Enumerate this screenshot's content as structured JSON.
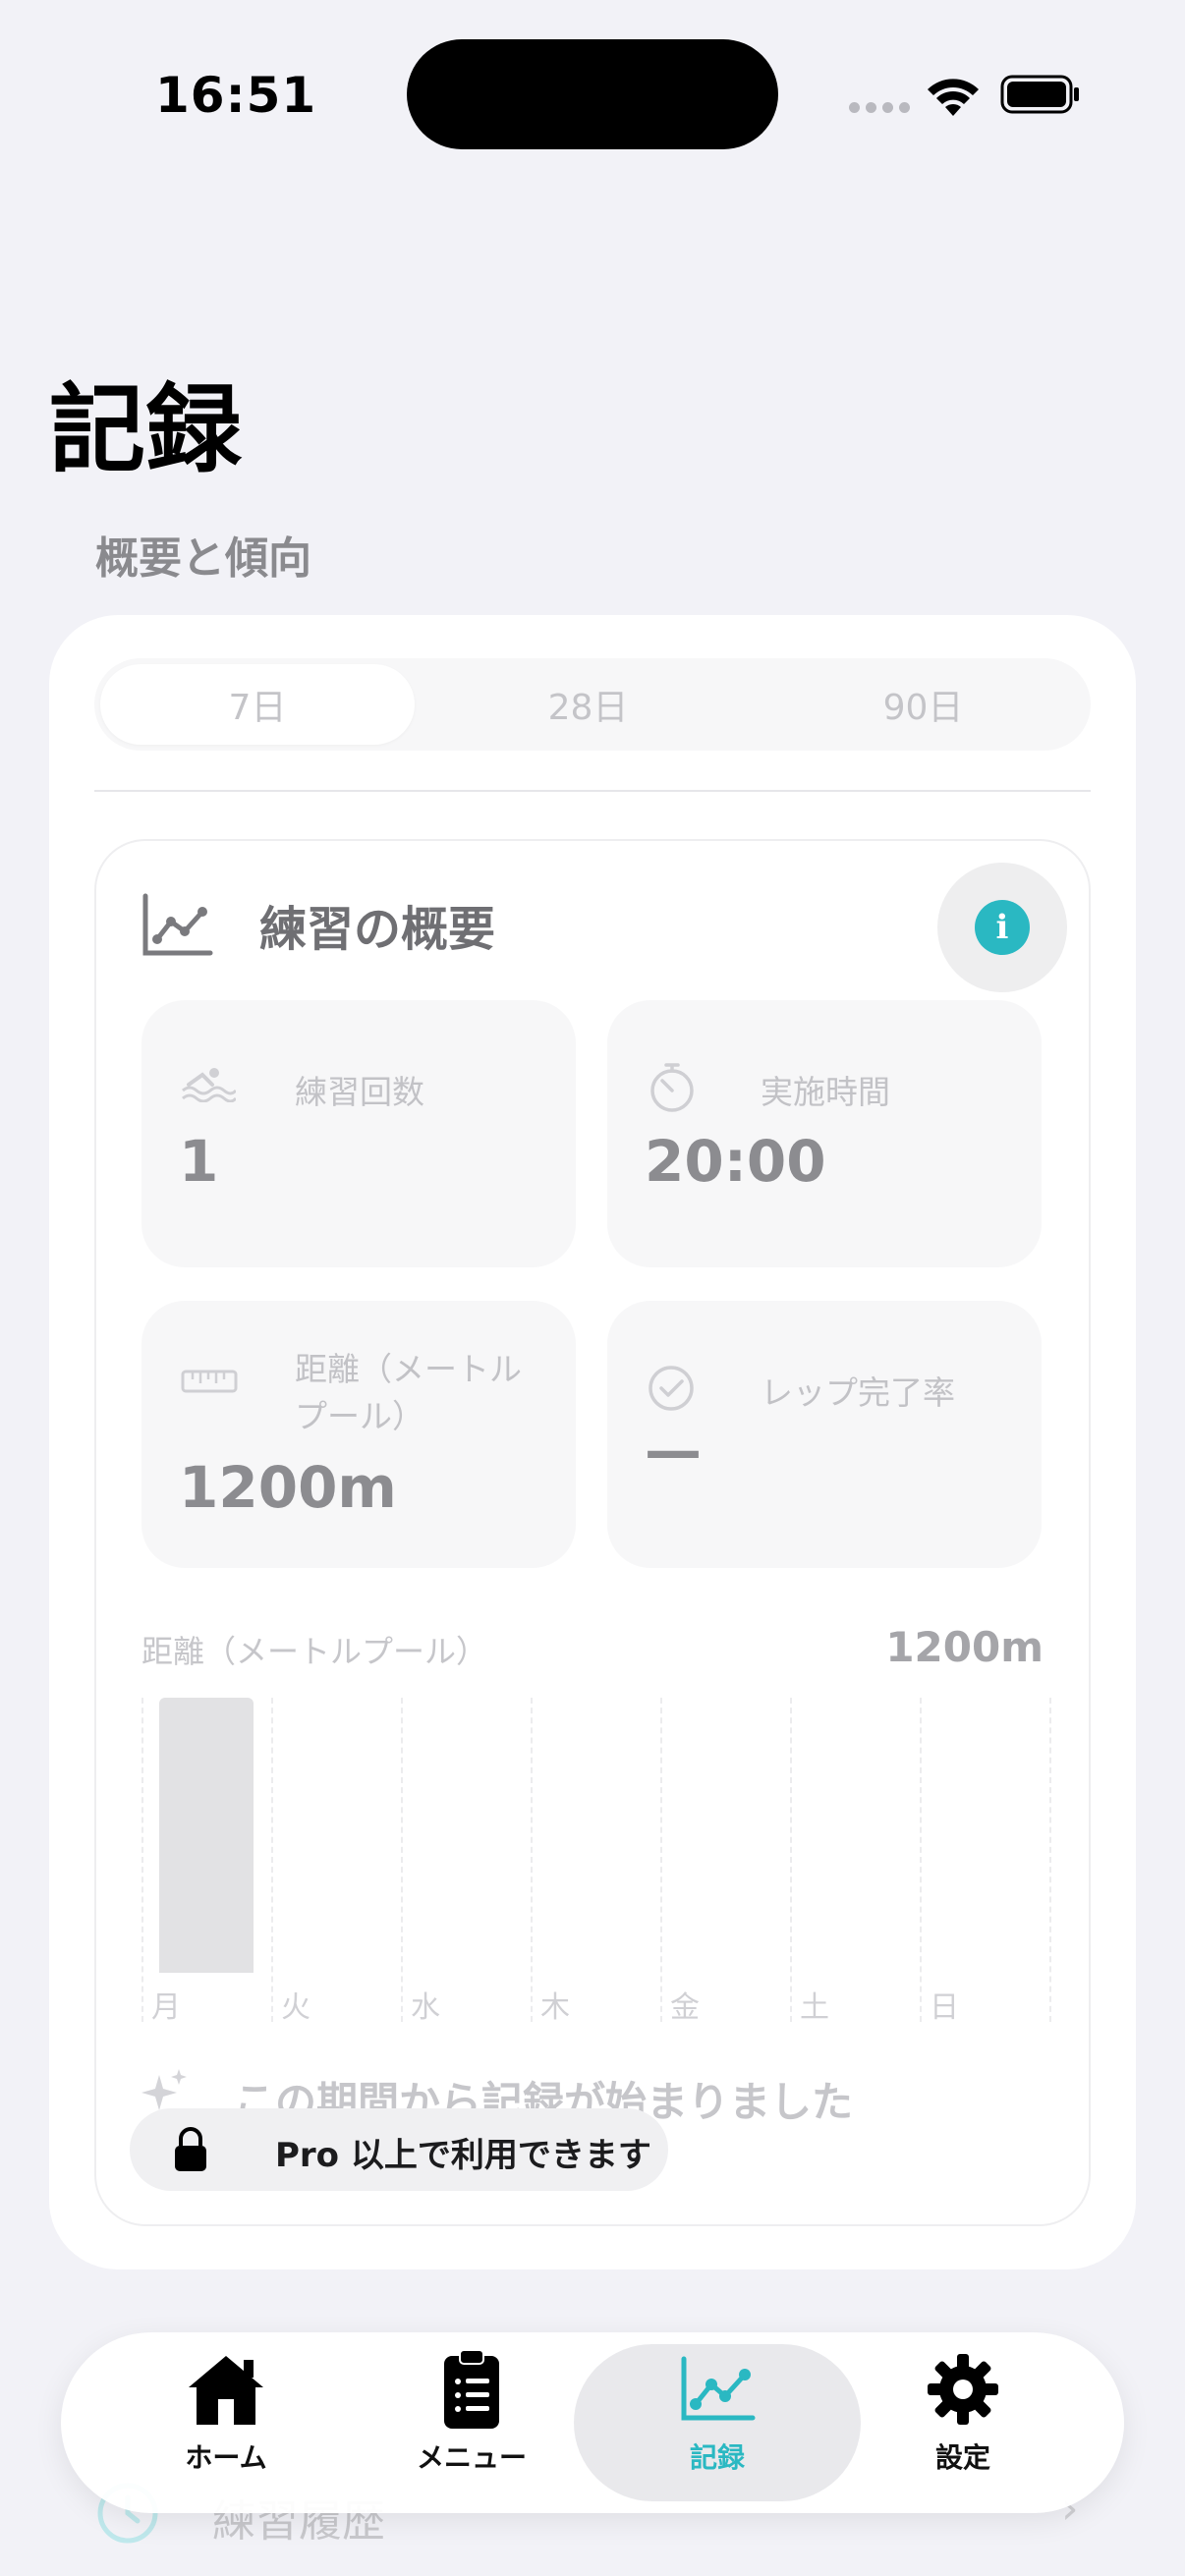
{
  "status_bar": {
    "time": "16:51"
  },
  "page": {
    "title": "記録",
    "section_label": "概要と傾向"
  },
  "period_tabs": [
    {
      "label": "7日",
      "active": true
    },
    {
      "label": "28日",
      "active": false
    },
    {
      "label": "90日",
      "active": false
    }
  ],
  "overview": {
    "title": "練習の概要",
    "stats": {
      "sessions": {
        "label": "練習回数",
        "value": "1"
      },
      "duration": {
        "label": "実施時間",
        "value": "20:00"
      },
      "distance": {
        "label": "距離（メートルプール）",
        "value": "1200m"
      },
      "completion": {
        "label": "レップ完了率",
        "value": "—"
      }
    }
  },
  "chart_data": {
    "type": "bar",
    "title": "距離（メートルプール）",
    "total_label": "1200m",
    "categories": [
      "月",
      "火",
      "水",
      "木",
      "金",
      "土",
      "日"
    ],
    "values": [
      1200,
      0,
      0,
      0,
      0,
      0,
      0
    ],
    "unit": "m",
    "ylim": [
      0,
      1200
    ]
  },
  "note": {
    "text": "この期間から記録が始まりました"
  },
  "lock": {
    "text": "Pro 以上で利用できます"
  },
  "behind_content": {
    "row_label": "練習履歴"
  },
  "tabbar": {
    "items": [
      {
        "label": "ホーム",
        "icon": "house-icon",
        "active": false
      },
      {
        "label": "メニュー",
        "icon": "clipboard-list-icon",
        "active": false
      },
      {
        "label": "記録",
        "icon": "chart-line-icon",
        "active": true
      },
      {
        "label": "設定",
        "icon": "gear-icon",
        "active": false
      }
    ]
  },
  "colors": {
    "accent": "#2ab8c2",
    "background": "#f2f2f7",
    "card": "#ffffff"
  }
}
